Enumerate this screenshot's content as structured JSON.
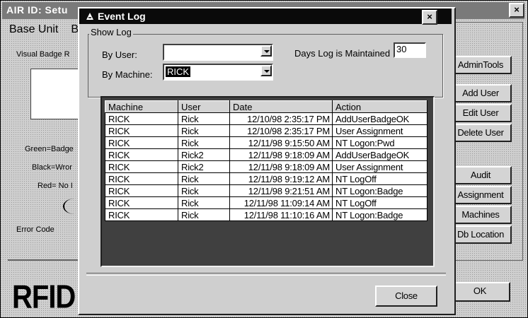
{
  "back_window": {
    "title": "AIR ID: Setu",
    "close": "×",
    "menu": [
      "Base Unit",
      "B"
    ],
    "labels": {
      "visual_badge": "Visual Badge R",
      "green": "Green=Badge",
      "black": "Black=Wror",
      "red": "Red= No I",
      "error_code": "Error Code"
    },
    "side_buttons": [
      "AdminTools",
      "Add User",
      "Edit User",
      "Delete User",
      "Audit",
      "Assignment",
      "Machines",
      "Db Location"
    ],
    "ok_button": "OK",
    "logo_text": "RFID"
  },
  "dialog": {
    "title": "Event Log",
    "close": "×",
    "group_label": "Show Log",
    "by_user_label": "By User:",
    "by_user_value": "",
    "by_machine_label": "By Machine:",
    "by_machine_value": "RICK",
    "days_label": "Days Log is Maintained",
    "days_value": "30",
    "close_button": "Close",
    "columns": [
      "Machine",
      "User",
      "Date",
      "Action"
    ],
    "rows": [
      [
        "RICK",
        "Rick",
        "12/10/98 2:35:17 PM",
        "AddUserBadgeOK"
      ],
      [
        "RICK",
        "Rick",
        "12/10/98 2:35:17 PM",
        "User Assignment"
      ],
      [
        "RICK",
        "Rick",
        "12/11/98 9:15:50 AM",
        "NT Logon:Pwd"
      ],
      [
        "RICK",
        "Rick2",
        "12/11/98 9:18:09 AM",
        "AddUserBadgeOK"
      ],
      [
        "RICK",
        "Rick2",
        "12/11/98 9:18:09 AM",
        "User Assignment"
      ],
      [
        "RICK",
        "Rick",
        "12/11/98 9:19:12 AM",
        "NT LogOff"
      ],
      [
        "RICK",
        "Rick",
        "12/11/98 9:21:51 AM",
        "NT Logon:Badge"
      ],
      [
        "RICK",
        "Rick",
        "12/11/98 11:09:14 AM",
        "NT LogOff"
      ],
      [
        "RICK",
        "Rick",
        "12/11/98 11:10:16 AM",
        "NT Logon:Badge"
      ]
    ]
  }
}
